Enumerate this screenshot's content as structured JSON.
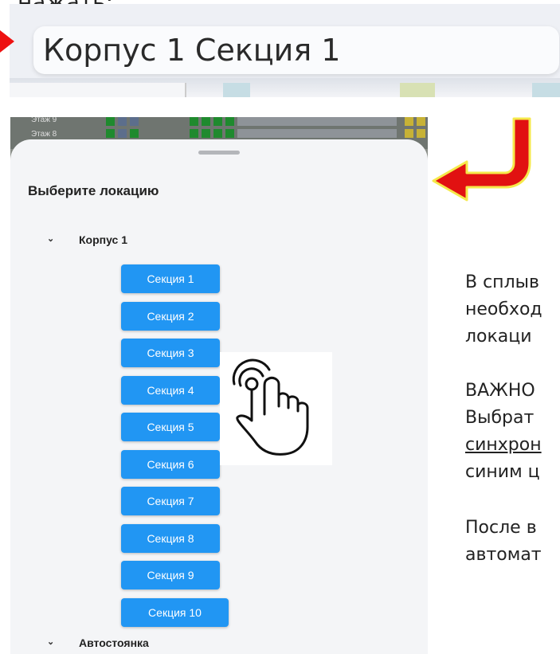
{
  "top_text": "нажать:",
  "location_bar": {
    "value": "Корпус 1 Секция 1"
  },
  "floors": [
    "Этаж 9",
    "Этаж 8"
  ],
  "sheet": {
    "title": "Выберите локацию",
    "groups": [
      {
        "label": "Корпус 1",
        "sections": [
          "Секция 1",
          "Секция 2",
          "Секция 3",
          "Секция 4",
          "Секция 5",
          "Секция 6",
          "Секция 7",
          "Секция 8",
          "Секция 9",
          "Секция 10"
        ]
      },
      {
        "label": "Автостоянка",
        "sections": []
      }
    ]
  },
  "instructions": {
    "line1": "В сплыв",
    "line2": "необход",
    "line3": "локаци",
    "line4": "ВАЖНО",
    "line5": "Выбрат",
    "line6": "синхрон",
    "line7": "синим ц",
    "line8": "После в",
    "line9": "автомат"
  },
  "colors": {
    "button": "#2196f3",
    "arrow": "#e11111",
    "arrow_outline": "#f5e94a"
  },
  "icons": {
    "chevron": "chevron-down-icon",
    "hand": "hand-tap-icon",
    "arrow": "red-curved-arrow-icon"
  }
}
